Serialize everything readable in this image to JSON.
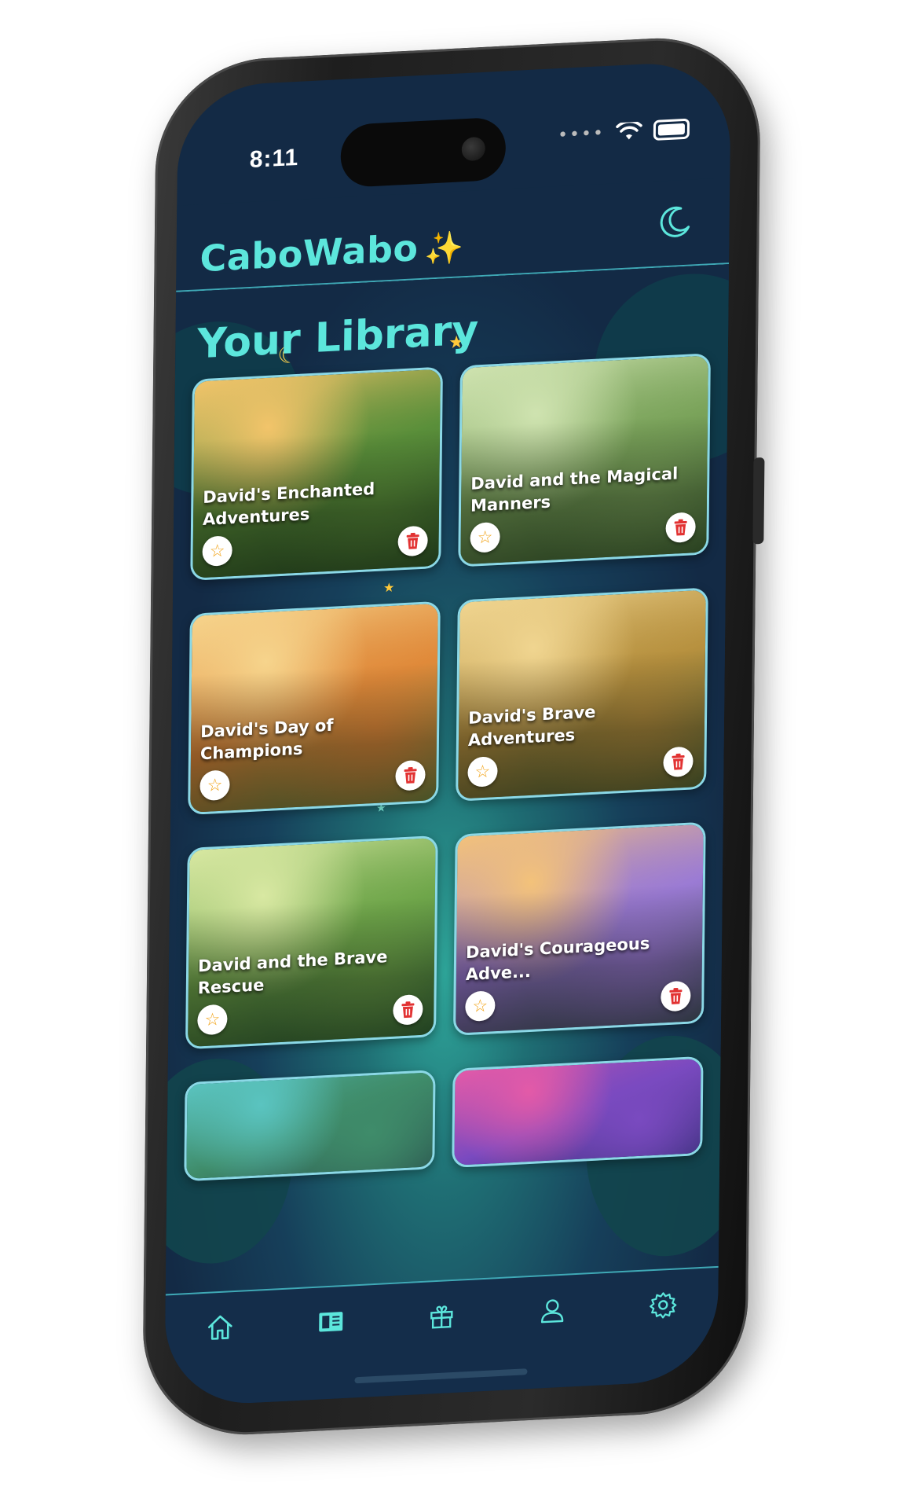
{
  "status_bar": {
    "time": "8:11"
  },
  "header": {
    "brand": "CaboWabo",
    "sparkle": "✨",
    "theme_toggle_icon": "moon-icon"
  },
  "library": {
    "title": "Your Library",
    "books": [
      {
        "title": "David's Enchanted Adventures",
        "palette": [
          "#f2c46a",
          "#5a8f3a",
          "#2e5a2a"
        ]
      },
      {
        "title": "David and the Magical Manners",
        "palette": [
          "#cfe3b0",
          "#7aa35a",
          "#3f6b33"
        ]
      },
      {
        "title": "David's Day of Champions",
        "palette": [
          "#f6d48c",
          "#e08a3a",
          "#6a9a4a"
        ]
      },
      {
        "title": "David's Brave Adventures",
        "palette": [
          "#f0d590",
          "#b7913f",
          "#4f6f3a"
        ]
      },
      {
        "title": "David and the Brave Rescue",
        "palette": [
          "#d8e8a2",
          "#6fa64a",
          "#2f6a3a"
        ]
      },
      {
        "title": "David's Courageous Adve...",
        "palette": [
          "#f3c27a",
          "#9b7bd4",
          "#3f5a5a"
        ]
      },
      {
        "title": "",
        "palette": [
          "#5ac4c0",
          "#3f8c6a",
          "#274a4a"
        ]
      },
      {
        "title": "",
        "palette": [
          "#e35aa8",
          "#7a4ac0",
          "#2c2a6a"
        ]
      }
    ],
    "favorite_icon": "star-icon",
    "delete_icon": "trash-icon"
  },
  "bottom_nav": [
    {
      "name": "home",
      "icon": "home-icon"
    },
    {
      "name": "library",
      "icon": "library-icon",
      "active": true
    },
    {
      "name": "gifts",
      "icon": "gift-icon"
    },
    {
      "name": "profile",
      "icon": "user-icon"
    },
    {
      "name": "settings",
      "icon": "gear-icon"
    }
  ],
  "colors": {
    "accent": "#5ce6dc",
    "background": "#132a45",
    "delete": "#e23232",
    "favorite": "#f2a51c"
  }
}
